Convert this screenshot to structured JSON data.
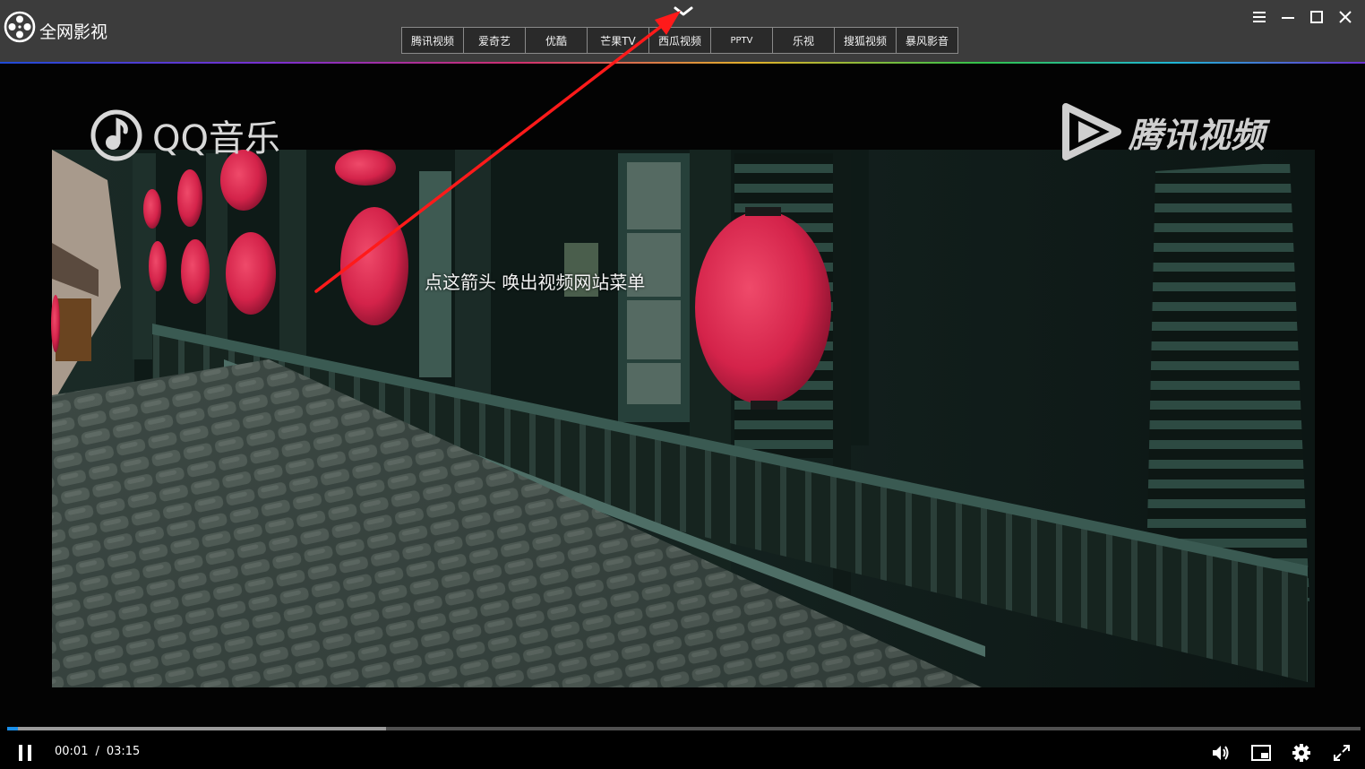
{
  "app": {
    "title": "全网影视",
    "logo_icon": "film-reel-icon"
  },
  "menu_toggle": {
    "icon": "chevron-down-icon"
  },
  "site_tabs": [
    {
      "label": "腾讯视频"
    },
    {
      "label": "爱奇艺"
    },
    {
      "label": "优酷"
    },
    {
      "label": "芒果TV"
    },
    {
      "label": "西瓜视频"
    },
    {
      "label": "PPTV"
    },
    {
      "label": "乐视"
    },
    {
      "label": "搜狐视频"
    },
    {
      "label": "暴风影音"
    }
  ],
  "window_controls": {
    "menu": "hamburger-icon",
    "minimize": "minimize-icon",
    "maximize": "maximize-icon",
    "close": "close-icon"
  },
  "video": {
    "watermark_left": "QQ音乐",
    "watermark_right": "腾讯视频",
    "hint": "点这箭头 唤出视频网站菜单"
  },
  "player": {
    "current_time": "00:01",
    "separator": "/",
    "duration": "03:15",
    "progress_played": 0.004,
    "progress_buffered": 0.28,
    "accent_color": "#1a8fe8",
    "icons": [
      "pause-icon",
      "volume-icon",
      "picture-in-picture-icon",
      "settings-icon",
      "fullscreen-icon"
    ]
  },
  "colors": {
    "titlebar": "#3c3c3c",
    "arrow": "#ff1a1a",
    "lantern": "#d4234a"
  }
}
